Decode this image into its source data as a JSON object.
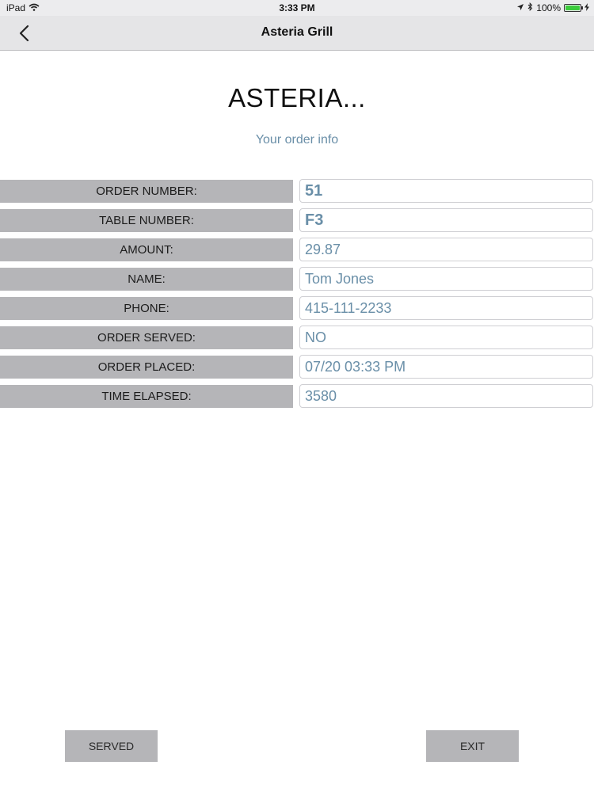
{
  "status_bar": {
    "device": "iPad",
    "time": "3:33 PM",
    "battery_text": "100%",
    "battery_level": 1.0
  },
  "nav": {
    "title": "Asteria Grill"
  },
  "header": {
    "title": "ASTERIA...",
    "subtitle": "Your order info"
  },
  "order_rows": [
    {
      "label": "ORDER NUMBER:",
      "value": "51"
    },
    {
      "label": "TABLE NUMBER:",
      "value": "F3"
    },
    {
      "label": "AMOUNT:",
      "value": "29.87"
    },
    {
      "label": "NAME:",
      "value": "Tom Jones"
    },
    {
      "label": "PHONE:",
      "value": "415-111-2233"
    },
    {
      "label": "ORDER SERVED:",
      "value": "NO"
    },
    {
      "label": "ORDER PLACED:",
      "value": "07/20 03:33 PM"
    },
    {
      "label": "TIME ELAPSED:",
      "value": "3580"
    }
  ],
  "buttons": {
    "served": "SERVED",
    "exit": "EXIT"
  },
  "colors": {
    "value_text": "#6a8fa8",
    "label_bg": "#b5b5b8",
    "battery_fill": "#3ccb3c"
  }
}
